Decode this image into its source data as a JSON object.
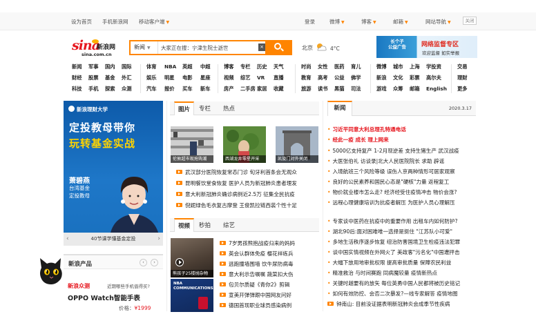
{
  "topbar": {
    "set_home": "设为首页",
    "mobile_sina": "手机新浪网",
    "mobile_client": "移动客户端",
    "login": "登录",
    "weibo": "微博",
    "blog": "博客",
    "mail": "邮箱",
    "site_nav": "网站导航",
    "close": "关闭"
  },
  "logo": {
    "sina": "sina",
    "xinlang": "新浪网",
    "domain": "sina.com.cn"
  },
  "search": {
    "category": "新闻",
    "value": "大家正在搜：宁津生院士逝世",
    "clear": "×"
  },
  "weather": {
    "city": "北京",
    "temp": "4°C",
    "icon": "sun-cloud-icon"
  },
  "ad_banner": {
    "left": "长个子 网络监督专区",
    "t1": "网络监督专区",
    "t2": "欢迎监督 如实举报"
  },
  "nav": {
    "col1": [
      [
        "新闻",
        "军事",
        "国内",
        "国际"
      ],
      [
        "财经",
        "股票",
        "基金",
        "外汇"
      ],
      [
        "科技",
        "手机",
        "探索",
        "众测"
      ]
    ],
    "col2": [
      [
        "体育",
        "NBA",
        "英超",
        "中超"
      ],
      [
        "娱乐",
        "明星",
        "电影",
        "星座"
      ],
      [
        "汽车",
        "报价",
        "买车",
        "新车"
      ]
    ],
    "col3": [
      [
        "博客",
        "专栏",
        "历史",
        "天气"
      ],
      [
        "视频",
        "综艺",
        "VR",
        "直播"
      ],
      [
        "房产",
        "二手房",
        "家居",
        "收藏"
      ]
    ],
    "col4": [
      [
        "时尚",
        "女性",
        "医药",
        "育儿"
      ],
      [
        "教育",
        "高考",
        "公益",
        "佛学"
      ],
      [
        "旅游",
        "读书",
        "黑猫",
        "司法"
      ]
    ],
    "col5": [
      [
        "微博",
        "城市",
        "上海",
        "学投资"
      ],
      [
        "新浪",
        "文化",
        "彩票",
        "高尔夫"
      ],
      [
        "游戏",
        "众筹",
        "邮箱",
        "English"
      ]
    ],
    "col6": [
      "交易",
      "理财",
      "更多"
    ]
  },
  "left_ad": {
    "brand": "新浪理财大学",
    "headline1": "定投教母带你",
    "headline2": "玩转基金实战",
    "person_name": "萧碧燕",
    "person_desc1": "台湾基金",
    "person_desc2": "定投教母",
    "caption": "40节课学懂基金定投",
    "prev": "‹",
    "next": "›"
  },
  "new_products": {
    "title": "新浪产品",
    "prev": "‹",
    "next": "›",
    "zhongce": "新浪众测",
    "zhongce_sub": "近期哪些手机值得买?",
    "oppo": "OPPO Watch智能手表",
    "price_label": "价格：",
    "price_value": "¥1999"
  },
  "pic_tabs": [
    "图片",
    "专栏",
    "热点"
  ],
  "thumbs": [
    {
      "caption": "伦敦超市现抢购潮"
    },
    {
      "caption": "西湖龙井零星开采"
    },
    {
      "caption": "凯旋门对外关闭"
    }
  ],
  "pic_news": [
    "武汉部分医院恢复常态门诊 旬牙利首条会无观众",
    "昆明餐饮堂食恢复 医护人员为新冠肺炎患者理发",
    "意大利新冠肺炎确诊病例近2.5万 征集全民抗疫",
    "倪妮绿色毛衣复古摩登 王俊凯拉链西装个性十足"
  ],
  "video_tabs": [
    "视频",
    "秒拍",
    "综艺"
  ],
  "video_thumbs": [
    {
      "caption": "熊孩子25楼抛杂物"
    },
    {
      "caption": "NBA COMMUNICATIONS"
    }
  ],
  "video_news": [
    "7岁男孩熊抱战疫归来的妈妈",
    "英会认群体免疫 樱花祥练兵",
    "逃跑撞墙围墙 饮牛尿防病毒",
    "意大利示告嘱嘱 蔬菜扣大伤",
    "包贝尔质疑《青你2》剪辑",
    "宣美开弹弹跟中国网友问好",
    "德国首现职业球员感染病例"
  ],
  "news": {
    "title": "新闻",
    "date": "2020.3.17",
    "headlines": [
      "习近平同意大利总理孔特通电话",
      "经此一疫 成长 理上网来"
    ],
    "items": [
      "5000亿支持复产 1-2月现逆差 支持生猪生产 武汉战疫",
      "大医张伯礼 访谈录|北大人民医院院长 求助 辟谣",
      "入境航班三个风险等级 误伤人京两种情形可居家观察",
      "良好的公民素养和国民心态是\"硬核\"力量 返程复工",
      "物价就业楼市怎么走? 经济经受住疫情冲击 物价会涨?",
      "远程心理健康培训为抗疫者解压 为医护人员心理解压"
    ],
    "items2": [
      "专家谈中医药在抗疫中的重要作用 出租车内如何防护?",
      "湖北90后:面对困难唯一选择是挺住 \"江苏队小可爱\"",
      "多地生活秩序逐步恢复 纽治防害国境卫生检疫违法犯罪",
      "谈中国实情视频在外网火了 美政客\"污名化\"中国遭抨击",
      "大幅下放用地审批权限 提高审批质量 保障农民利益",
      "精准救治 与时间赛跑 同病魔较量 疫情新热点",
      "关键时越要有的放矢 每位英勇中国人民都将被历史铭记",
      "如何有效防控、会否二次暴发?—线专家解答 疫情地图",
      "钟南山: 目前没证据表明新冠肺炎会成季节性疾病"
    ]
  }
}
